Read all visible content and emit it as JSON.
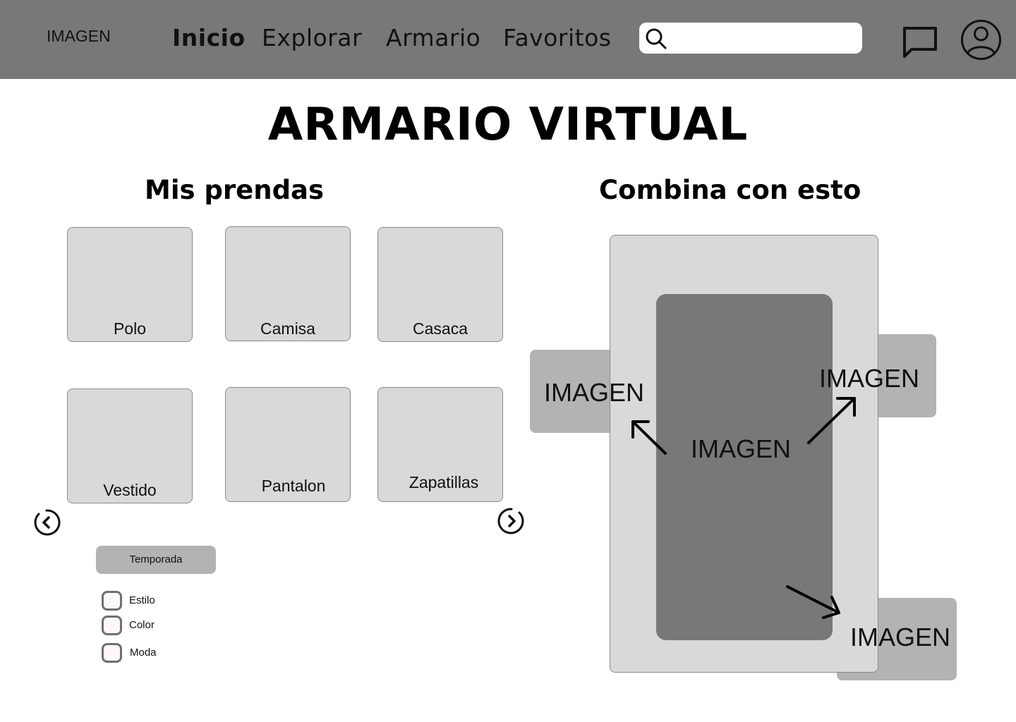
{
  "header": {
    "logo": "IMAGEN",
    "nav": [
      "Inicio",
      "Explorar",
      "Armario",
      "Favoritos"
    ],
    "active_nav": "Inicio",
    "search": {
      "value": "",
      "placeholder": ""
    },
    "background": "#787878"
  },
  "page": {
    "title": "ARMARIO VIRTUAL"
  },
  "wardrobe": {
    "title": "Mis prendas",
    "items": [
      "Polo",
      "Camisa",
      "Casaca",
      "Vestido",
      "Pantalon",
      "Zapatillas"
    ],
    "prev_icon": "chevron-left-circle-icon",
    "next_icon": "chevron-right-circle-icon"
  },
  "filters": {
    "season_button": "Temporada",
    "options": [
      {
        "label": "Estilo",
        "checked": false
      },
      {
        "label": "Color",
        "checked": false
      },
      {
        "label": "Moda",
        "checked": false
      }
    ]
  },
  "combine": {
    "title": "Combina con esto",
    "center_image": "IMAGEN",
    "left_image": "IMAGEN",
    "right_image": "IMAGEN",
    "bottom_image": "IMAGEN"
  },
  "colors": {
    "header": "#787878",
    "card": "#d9d9d9",
    "side_box": "#b3b3b3",
    "center_box": "#787878"
  }
}
